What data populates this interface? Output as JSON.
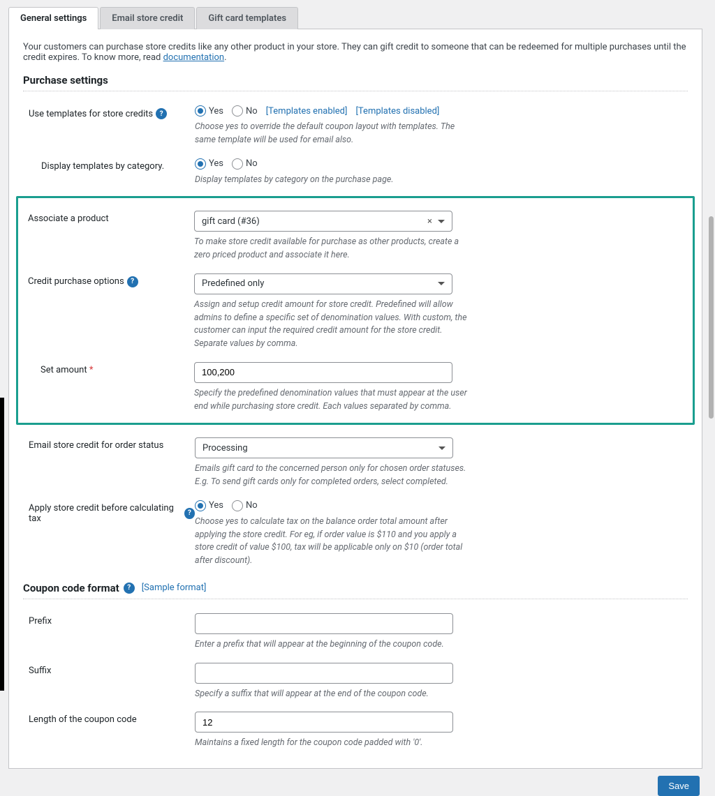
{
  "tabs": {
    "general": "General settings",
    "email": "Email store credit",
    "gift": "Gift card templates"
  },
  "intro": {
    "text1": "Your customers can purchase store credits like any other product in your store. They can gift credit to someone that can be redeemed for multiple purchases until the credit expires. To know more, read ",
    "link": "documentation",
    "text2": "."
  },
  "purchase": {
    "title": "Purchase settings",
    "useTemplates": {
      "label": "Use templates for store credits",
      "yes": "Yes",
      "no": "No",
      "link1": "[Templates enabled]",
      "link2": "[Templates disabled]",
      "help": "Choose yes to override the default coupon layout with templates. The same template will be used for email also."
    },
    "displayByCategory": {
      "label": "Display templates by category.",
      "yes": "Yes",
      "no": "No",
      "help": "Display templates by category on the purchase page."
    },
    "associate": {
      "label": "Associate a product",
      "value": "gift card (#36)",
      "help": "To make store credit available for purchase as other products, create a zero priced product and associate it here."
    },
    "creditOptions": {
      "label": "Credit purchase options",
      "value": "Predefined only",
      "help": "Assign and setup credit amount for store credit. Predefined will allow admins to define a specific set of denomination values. With custom, the customer can input the required credit amount for the store credit. Separate values by comma."
    },
    "setAmount": {
      "label": "Set amount",
      "value": "100,200",
      "help": "Specify the predefined denomination values that must appear at the user end while purchasing store credit. Each values separated by comma."
    },
    "emailStatus": {
      "label": "Email store credit for order status",
      "value": "Processing",
      "help": "Emails gift card to the concerned person only for chosen order statuses. E.g. To send gift cards only for completed orders, select completed."
    },
    "beforeTax": {
      "label": "Apply store credit before calculating tax",
      "yes": "Yes",
      "no": "No",
      "help": "Choose yes to calculate tax on the balance order total amount after applying the store credit. For eg, if order value is $110 and you apply a store credit of value $100, tax will be applicable only on $10 (order total after discount)."
    }
  },
  "coupon": {
    "title": "Coupon code format",
    "sample": "[Sample format]",
    "prefix": {
      "label": "Prefix",
      "value": "",
      "help": "Enter a prefix that will appear at the beginning of the coupon code."
    },
    "suffix": {
      "label": "Suffix",
      "value": "",
      "help": "Specify a suffix that will appear at the end of the coupon code."
    },
    "length": {
      "label": "Length of the coupon code",
      "value": "12",
      "help": "Maintains a fixed length for the coupon code padded with '0'."
    }
  },
  "buttons": {
    "save": "Save"
  },
  "glyph": {
    "close": "×",
    "help": "?",
    "star": "*"
  }
}
